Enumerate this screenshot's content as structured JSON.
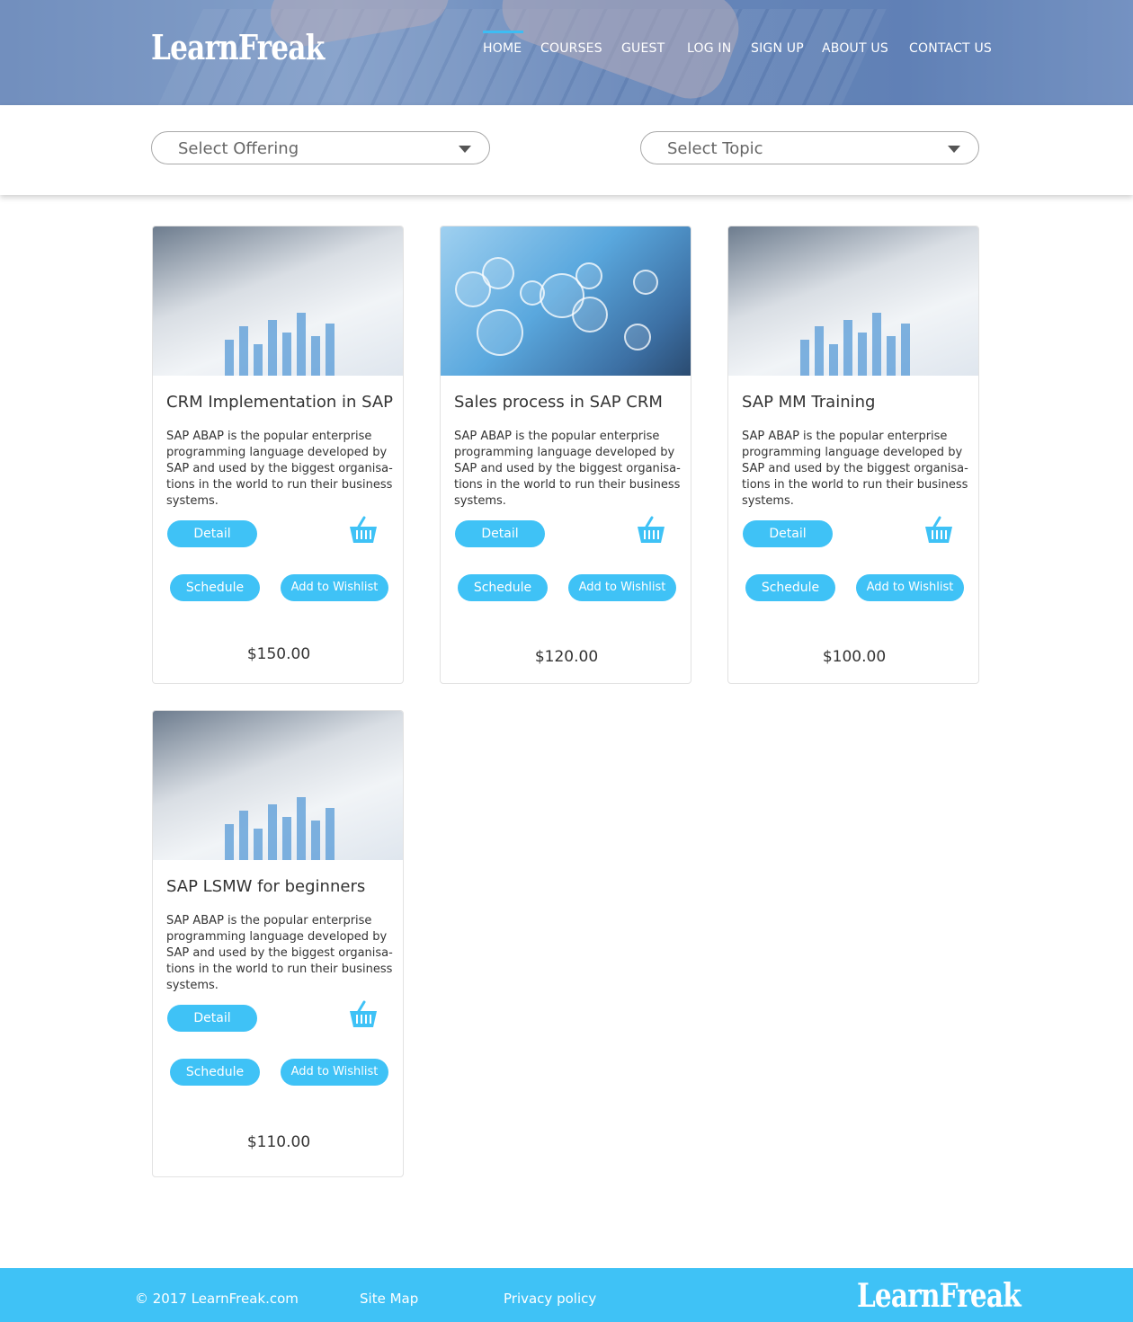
{
  "header": {
    "logo": "LearnFreak",
    "nav": [
      {
        "label": "HOME",
        "active": true
      },
      {
        "label": "COURSES",
        "active": false
      },
      {
        "label": "GUEST",
        "active": false
      },
      {
        "label": "LOG IN",
        "active": false
      },
      {
        "label": "SIGN UP",
        "active": false
      },
      {
        "label": "ABOUT US",
        "active": false
      },
      {
        "label": "CONTACT US",
        "active": false
      }
    ]
  },
  "filters": {
    "offering": "Select Offering",
    "topic": "Select Topic"
  },
  "buttons": {
    "detail": "Detail",
    "schedule": "Schedule",
    "wishlist": "Add to Wishlist"
  },
  "courses": [
    {
      "title": "CRM Implementation in SAP",
      "description": "SAP ABAP is the popular enterprise programming language developed by SAP and used by the biggest organisa-tions in the world to run their business systems.",
      "price": "$150.00",
      "image": "chart-document-photo"
    },
    {
      "title": "Sales process in SAP CRM",
      "description": "SAP ABAP is the popular enterprise programming language developed by SAP and used by the biggest organisa-tions in the world to run their business systems.",
      "price": "$120.00",
      "image": "social-network-photo"
    },
    {
      "title": "SAP MM Training",
      "description": "SAP ABAP is the popular enterprise programming language developed by SAP and used by the biggest organisa-tions in the world to run their business systems.",
      "price": "$100.00",
      "image": "chart-document-photo"
    },
    {
      "title": "SAP LSMW for beginners",
      "description": "SAP ABAP is the popular enterprise programming language developed by SAP and used by the biggest organisa-tions in the world to run their business systems.",
      "price": "$110.00",
      "image": "chart-document-photo"
    }
  ],
  "footer": {
    "copyright": "© 2017 LearnFreak.com",
    "sitemap": "Site Map",
    "privacy": "Privacy policy",
    "logo": "LearnFreak"
  },
  "colors": {
    "accent": "#3fc2f6",
    "nav_active": "#3dbdf4",
    "text": "#333333"
  },
  "icons": {
    "basket": "shopping-basket-icon",
    "caret": "caret-down-icon"
  }
}
